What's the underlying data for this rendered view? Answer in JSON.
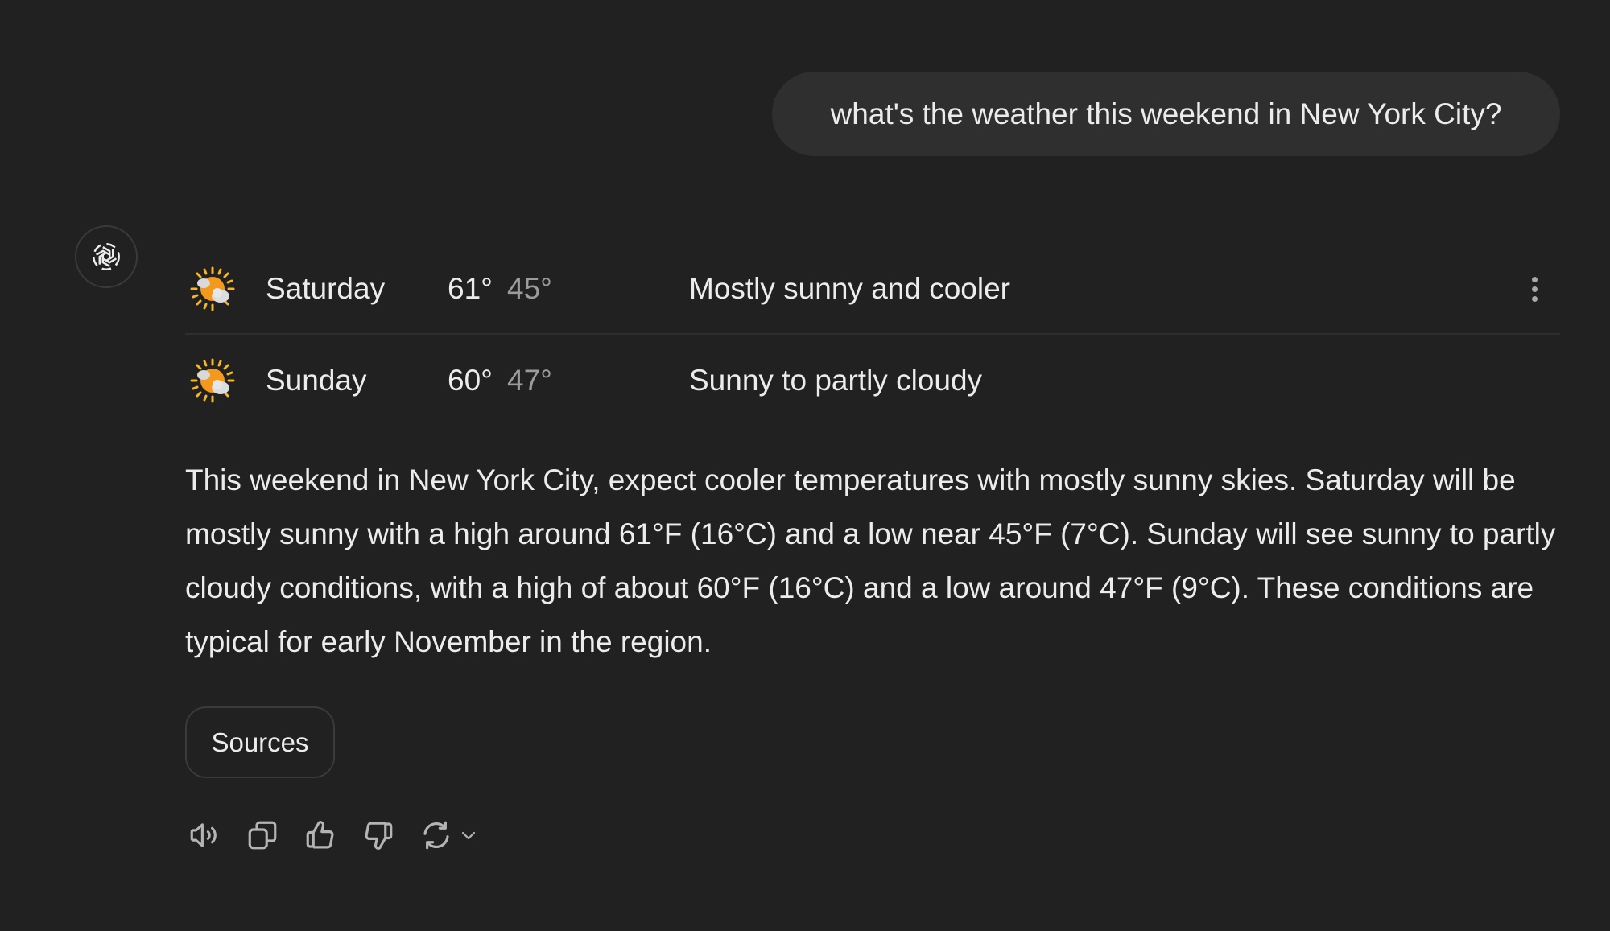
{
  "user_message": "what's the weather this weekend in New York City?",
  "assistant": {
    "avatar_icon": "openai-logo-icon",
    "forecast": [
      {
        "day": "Saturday",
        "high": "61°",
        "low": "45°",
        "description": "Mostly sunny and cooler",
        "icon": "partly-sunny-icon"
      },
      {
        "day": "Sunday",
        "high": "60°",
        "low": "47°",
        "description": "Sunny to partly cloudy",
        "icon": "partly-sunny-icon"
      }
    ],
    "more_options_icon": "vertical-ellipsis-icon",
    "summary": "This weekend in New York City, expect cooler temperatures with mostly sunny skies. Saturday will be mostly sunny with a high around 61°F (16°C) and a low near 45°F (7°C). Sunday will see sunny to partly cloudy conditions, with a high of about 60°F (16°C) and a low around 47°F (9°C). These conditions are typical for early November in the region.",
    "sources_label": "Sources",
    "actions": [
      {
        "name": "read-aloud",
        "icon": "speaker-icon"
      },
      {
        "name": "copy",
        "icon": "copy-icon"
      },
      {
        "name": "good-response",
        "icon": "thumbs-up-icon"
      },
      {
        "name": "bad-response",
        "icon": "thumbs-down-icon"
      },
      {
        "name": "regenerate",
        "icon": "refresh-icon"
      },
      {
        "name": "model-switch",
        "icon": "chevron-down-icon"
      }
    ]
  },
  "colors": {
    "background": "#212121",
    "user_bubble": "#2f2f2f",
    "text_primary": "#ececec",
    "text_secondary": "#9b9b9b",
    "sun": "#f39a1e"
  }
}
